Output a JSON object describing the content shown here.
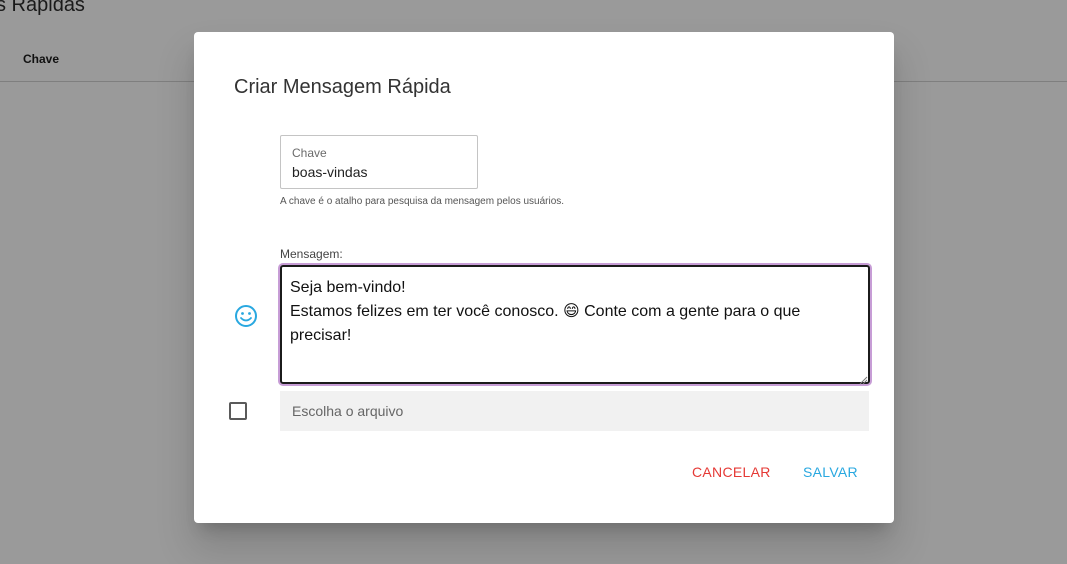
{
  "background": {
    "title": "s Rápidas",
    "column_header": "Chave"
  },
  "dialog": {
    "title": "Criar Mensagem Rápida",
    "key_field": {
      "label": "Chave",
      "value": "boas-vindas",
      "helper": "A chave é o atalho para pesquisa da mensagem pelos usuários."
    },
    "message": {
      "label": "Mensagem:",
      "value": "Seja bem-vindo!\nEstamos felizes em ter você conosco. 😄 Conte com a gente para o que precisar!",
      "emoji_icon": "smiley-icon"
    },
    "file": {
      "checked": false,
      "placeholder": "Escolha o arquivo"
    },
    "actions": {
      "cancel_label": "CANCELAR",
      "save_label": "SALVAR"
    }
  },
  "colors": {
    "overlay": "#9a9a9a",
    "cancel": "#e53935",
    "save": "#29a8e0",
    "emoji_icon": "#29a8e0",
    "focus_ring": "#c79dd6"
  }
}
